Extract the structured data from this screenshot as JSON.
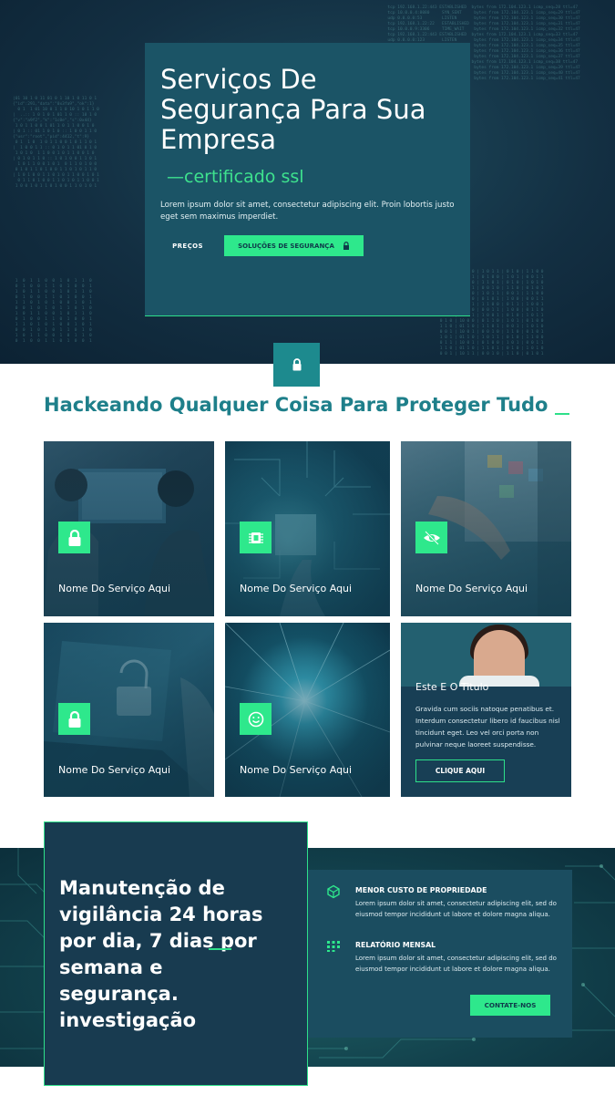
{
  "hero": {
    "title": "Serviços De Segurança Para Sua Empresa",
    "tagline": "—certificado ssl",
    "text": "Lorem ipsum dolor sit amet, consectetur adipiscing elit. Proin lobortis justo eget sem maximus imperdiet.",
    "btn_prices": "PREÇOS",
    "btn_solutions": "SOLUÇÕES DE SEGURANÇA"
  },
  "services": {
    "title": "Hackeando Qualquer Coisa Para Proteger Tudo",
    "tiles": [
      {
        "name": "Nome Do Serviço Aqui",
        "icon": "lock-icon"
      },
      {
        "name": "Nome Do Serviço Aqui",
        "icon": "chip-icon"
      },
      {
        "name": "Nome Do Serviço Aqui",
        "icon": "eye-off-icon"
      },
      {
        "name": "Nome Do Serviço Aqui",
        "icon": "lock-icon"
      },
      {
        "name": "Nome Do Serviço Aqui",
        "icon": "smiley-icon"
      }
    ],
    "featured": {
      "title": "Este E O Titulo",
      "text": "Gravida cum sociis natoque penatibus et. Interdum consectetur libero id faucibus nisl tincidunt eget. Leo vel orci porta non pulvinar neque laoreet suspendisse.",
      "button": "CLIQUE AQUI"
    }
  },
  "maintenance": {
    "title": "Manutenção de vigilância 24 horas por dia, 7 dias por semana e segurança. investigação",
    "features": [
      {
        "heading": "MENOR CUSTO DE PROPRIEDADE",
        "text": "Lorem ipsum dolor sit amet, consectetur adipiscing elit, sed do eiusmod tempor incididunt ut labore et dolore magna aliqua.",
        "icon": "cube-icon"
      },
      {
        "heading": "RELATÓRIO MENSAL",
        "text": "Lorem ipsum dolor sit amet, consectetur adipiscing elit, sed do eiusmod tempor incididunt ut labore et dolore magna aliqua.",
        "icon": "dots-grid-icon"
      }
    ],
    "button": "CONTATE-NOS"
  },
  "colors": {
    "accent": "#2ee88c",
    "teal_dark": "#183b50",
    "section_title": "#1e7f8a"
  }
}
